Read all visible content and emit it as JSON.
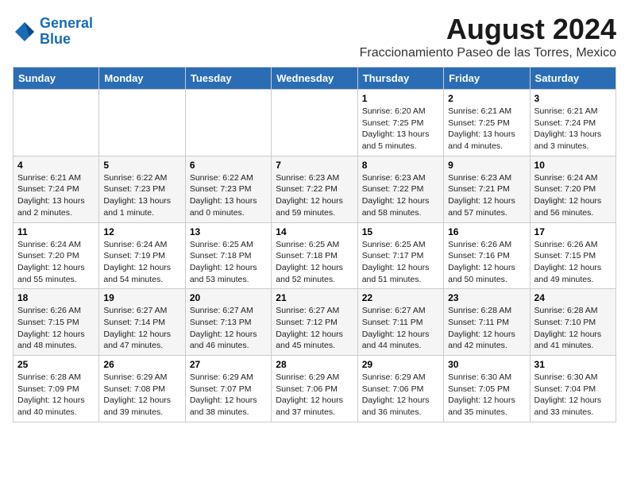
{
  "header": {
    "logo_line1": "General",
    "logo_line2": "Blue",
    "title": "August 2024",
    "subtitle": "Fraccionamiento Paseo de las Torres, Mexico"
  },
  "weekdays": [
    "Sunday",
    "Monday",
    "Tuesday",
    "Wednesday",
    "Thursday",
    "Friday",
    "Saturday"
  ],
  "weeks": [
    [
      {
        "day": "",
        "info": ""
      },
      {
        "day": "",
        "info": ""
      },
      {
        "day": "",
        "info": ""
      },
      {
        "day": "",
        "info": ""
      },
      {
        "day": "1",
        "info": "Sunrise: 6:20 AM\nSunset: 7:25 PM\nDaylight: 13 hours\nand 5 minutes."
      },
      {
        "day": "2",
        "info": "Sunrise: 6:21 AM\nSunset: 7:25 PM\nDaylight: 13 hours\nand 4 minutes."
      },
      {
        "day": "3",
        "info": "Sunrise: 6:21 AM\nSunset: 7:24 PM\nDaylight: 13 hours\nand 3 minutes."
      }
    ],
    [
      {
        "day": "4",
        "info": "Sunrise: 6:21 AM\nSunset: 7:24 PM\nDaylight: 13 hours\nand 2 minutes."
      },
      {
        "day": "5",
        "info": "Sunrise: 6:22 AM\nSunset: 7:23 PM\nDaylight: 13 hours\nand 1 minute."
      },
      {
        "day": "6",
        "info": "Sunrise: 6:22 AM\nSunset: 7:23 PM\nDaylight: 13 hours\nand 0 minutes."
      },
      {
        "day": "7",
        "info": "Sunrise: 6:23 AM\nSunset: 7:22 PM\nDaylight: 12 hours\nand 59 minutes."
      },
      {
        "day": "8",
        "info": "Sunrise: 6:23 AM\nSunset: 7:22 PM\nDaylight: 12 hours\nand 58 minutes."
      },
      {
        "day": "9",
        "info": "Sunrise: 6:23 AM\nSunset: 7:21 PM\nDaylight: 12 hours\nand 57 minutes."
      },
      {
        "day": "10",
        "info": "Sunrise: 6:24 AM\nSunset: 7:20 PM\nDaylight: 12 hours\nand 56 minutes."
      }
    ],
    [
      {
        "day": "11",
        "info": "Sunrise: 6:24 AM\nSunset: 7:20 PM\nDaylight: 12 hours\nand 55 minutes."
      },
      {
        "day": "12",
        "info": "Sunrise: 6:24 AM\nSunset: 7:19 PM\nDaylight: 12 hours\nand 54 minutes."
      },
      {
        "day": "13",
        "info": "Sunrise: 6:25 AM\nSunset: 7:18 PM\nDaylight: 12 hours\nand 53 minutes."
      },
      {
        "day": "14",
        "info": "Sunrise: 6:25 AM\nSunset: 7:18 PM\nDaylight: 12 hours\nand 52 minutes."
      },
      {
        "day": "15",
        "info": "Sunrise: 6:25 AM\nSunset: 7:17 PM\nDaylight: 12 hours\nand 51 minutes."
      },
      {
        "day": "16",
        "info": "Sunrise: 6:26 AM\nSunset: 7:16 PM\nDaylight: 12 hours\nand 50 minutes."
      },
      {
        "day": "17",
        "info": "Sunrise: 6:26 AM\nSunset: 7:15 PM\nDaylight: 12 hours\nand 49 minutes."
      }
    ],
    [
      {
        "day": "18",
        "info": "Sunrise: 6:26 AM\nSunset: 7:15 PM\nDaylight: 12 hours\nand 48 minutes."
      },
      {
        "day": "19",
        "info": "Sunrise: 6:27 AM\nSunset: 7:14 PM\nDaylight: 12 hours\nand 47 minutes."
      },
      {
        "day": "20",
        "info": "Sunrise: 6:27 AM\nSunset: 7:13 PM\nDaylight: 12 hours\nand 46 minutes."
      },
      {
        "day": "21",
        "info": "Sunrise: 6:27 AM\nSunset: 7:12 PM\nDaylight: 12 hours\nand 45 minutes."
      },
      {
        "day": "22",
        "info": "Sunrise: 6:27 AM\nSunset: 7:11 PM\nDaylight: 12 hours\nand 44 minutes."
      },
      {
        "day": "23",
        "info": "Sunrise: 6:28 AM\nSunset: 7:11 PM\nDaylight: 12 hours\nand 42 minutes."
      },
      {
        "day": "24",
        "info": "Sunrise: 6:28 AM\nSunset: 7:10 PM\nDaylight: 12 hours\nand 41 minutes."
      }
    ],
    [
      {
        "day": "25",
        "info": "Sunrise: 6:28 AM\nSunset: 7:09 PM\nDaylight: 12 hours\nand 40 minutes."
      },
      {
        "day": "26",
        "info": "Sunrise: 6:29 AM\nSunset: 7:08 PM\nDaylight: 12 hours\nand 39 minutes."
      },
      {
        "day": "27",
        "info": "Sunrise: 6:29 AM\nSunset: 7:07 PM\nDaylight: 12 hours\nand 38 minutes."
      },
      {
        "day": "28",
        "info": "Sunrise: 6:29 AM\nSunset: 7:06 PM\nDaylight: 12 hours\nand 37 minutes."
      },
      {
        "day": "29",
        "info": "Sunrise: 6:29 AM\nSunset: 7:06 PM\nDaylight: 12 hours\nand 36 minutes."
      },
      {
        "day": "30",
        "info": "Sunrise: 6:30 AM\nSunset: 7:05 PM\nDaylight: 12 hours\nand 35 minutes."
      },
      {
        "day": "31",
        "info": "Sunrise: 6:30 AM\nSunset: 7:04 PM\nDaylight: 12 hours\nand 33 minutes."
      }
    ]
  ]
}
